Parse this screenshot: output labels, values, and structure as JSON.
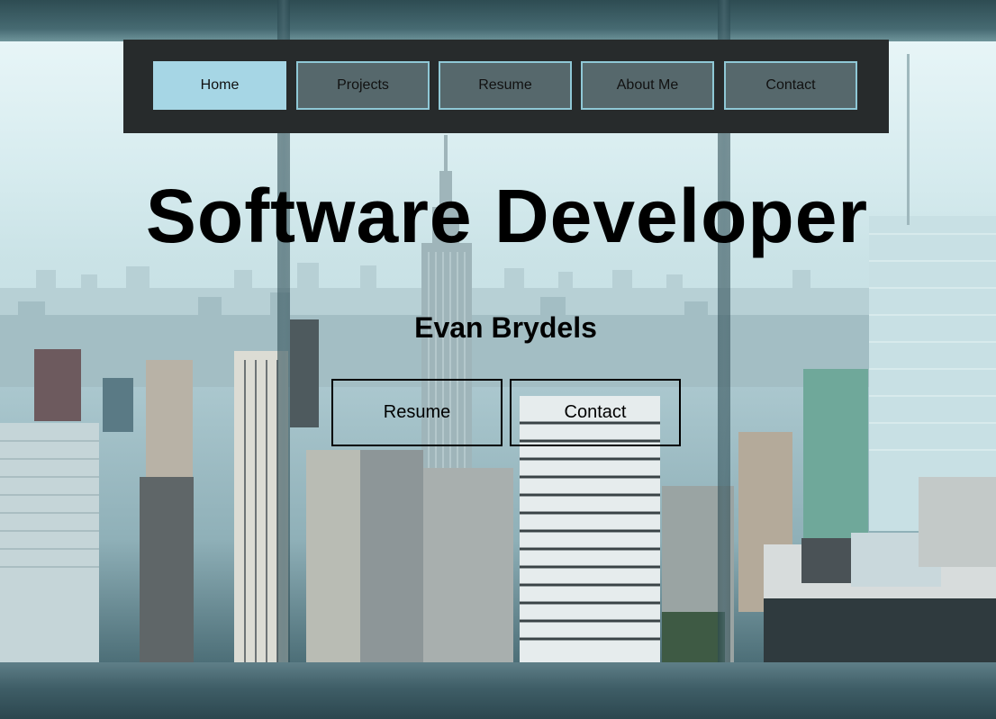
{
  "nav": {
    "items": [
      {
        "label": "Home",
        "active": true
      },
      {
        "label": "Projects",
        "active": false
      },
      {
        "label": "Resume",
        "active": false
      },
      {
        "label": "About Me",
        "active": false
      },
      {
        "label": "Contact",
        "active": false
      }
    ]
  },
  "hero": {
    "title": "Software Developer",
    "name": "Evan Brydels",
    "buttons": [
      {
        "label": "Resume"
      },
      {
        "label": "Contact"
      }
    ]
  },
  "colors": {
    "nav_background": "#272b2c",
    "nav_active": "#a6d6e5",
    "nav_inactive": "#56686c",
    "nav_border": "#8fc8d6"
  }
}
